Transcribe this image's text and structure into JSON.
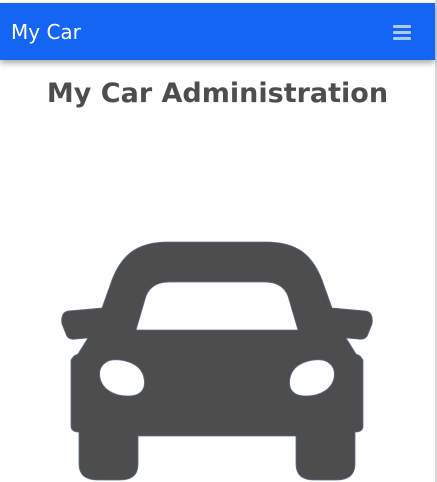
{
  "navbar": {
    "brand": "My Car",
    "menu_icon": "hamburger-menu-icon",
    "background_color": "#1565f5"
  },
  "main": {
    "title": "My Car Administration",
    "hero_icon": "car-icon",
    "icon_color": "#4d4d4d"
  }
}
